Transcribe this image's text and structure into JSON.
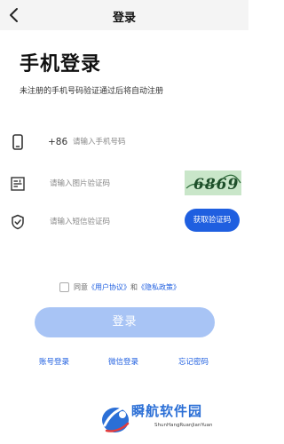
{
  "navbar": {
    "title": "登录"
  },
  "page": {
    "title": "手机登录",
    "subtitle": "未注册的手机号码验证通过后将自动注册"
  },
  "phone": {
    "prefix": "+86",
    "placeholder": "请输入手机号码"
  },
  "captcha": {
    "placeholder": "请输入图片验证码",
    "image_text": "6869"
  },
  "sms": {
    "placeholder": "请输入短信验证码",
    "button_label": "获取验证码"
  },
  "agreement": {
    "prefix": "同意",
    "user_agreement": "《用户协议》",
    "and": "和",
    "privacy_policy": "《隐私政策》"
  },
  "login_button": "登录",
  "links": {
    "account_login": "账号登录",
    "wechat_login": "微信登录",
    "forgot_password": "忘记密码"
  },
  "watermark": {
    "text": "瞬航软件园",
    "sub": "ShunHangRuanJianYuan"
  },
  "colors": {
    "accent": "#1f5fe0",
    "login_button": "#a8c4f5",
    "captcha_bg": "#c9e6c9"
  }
}
